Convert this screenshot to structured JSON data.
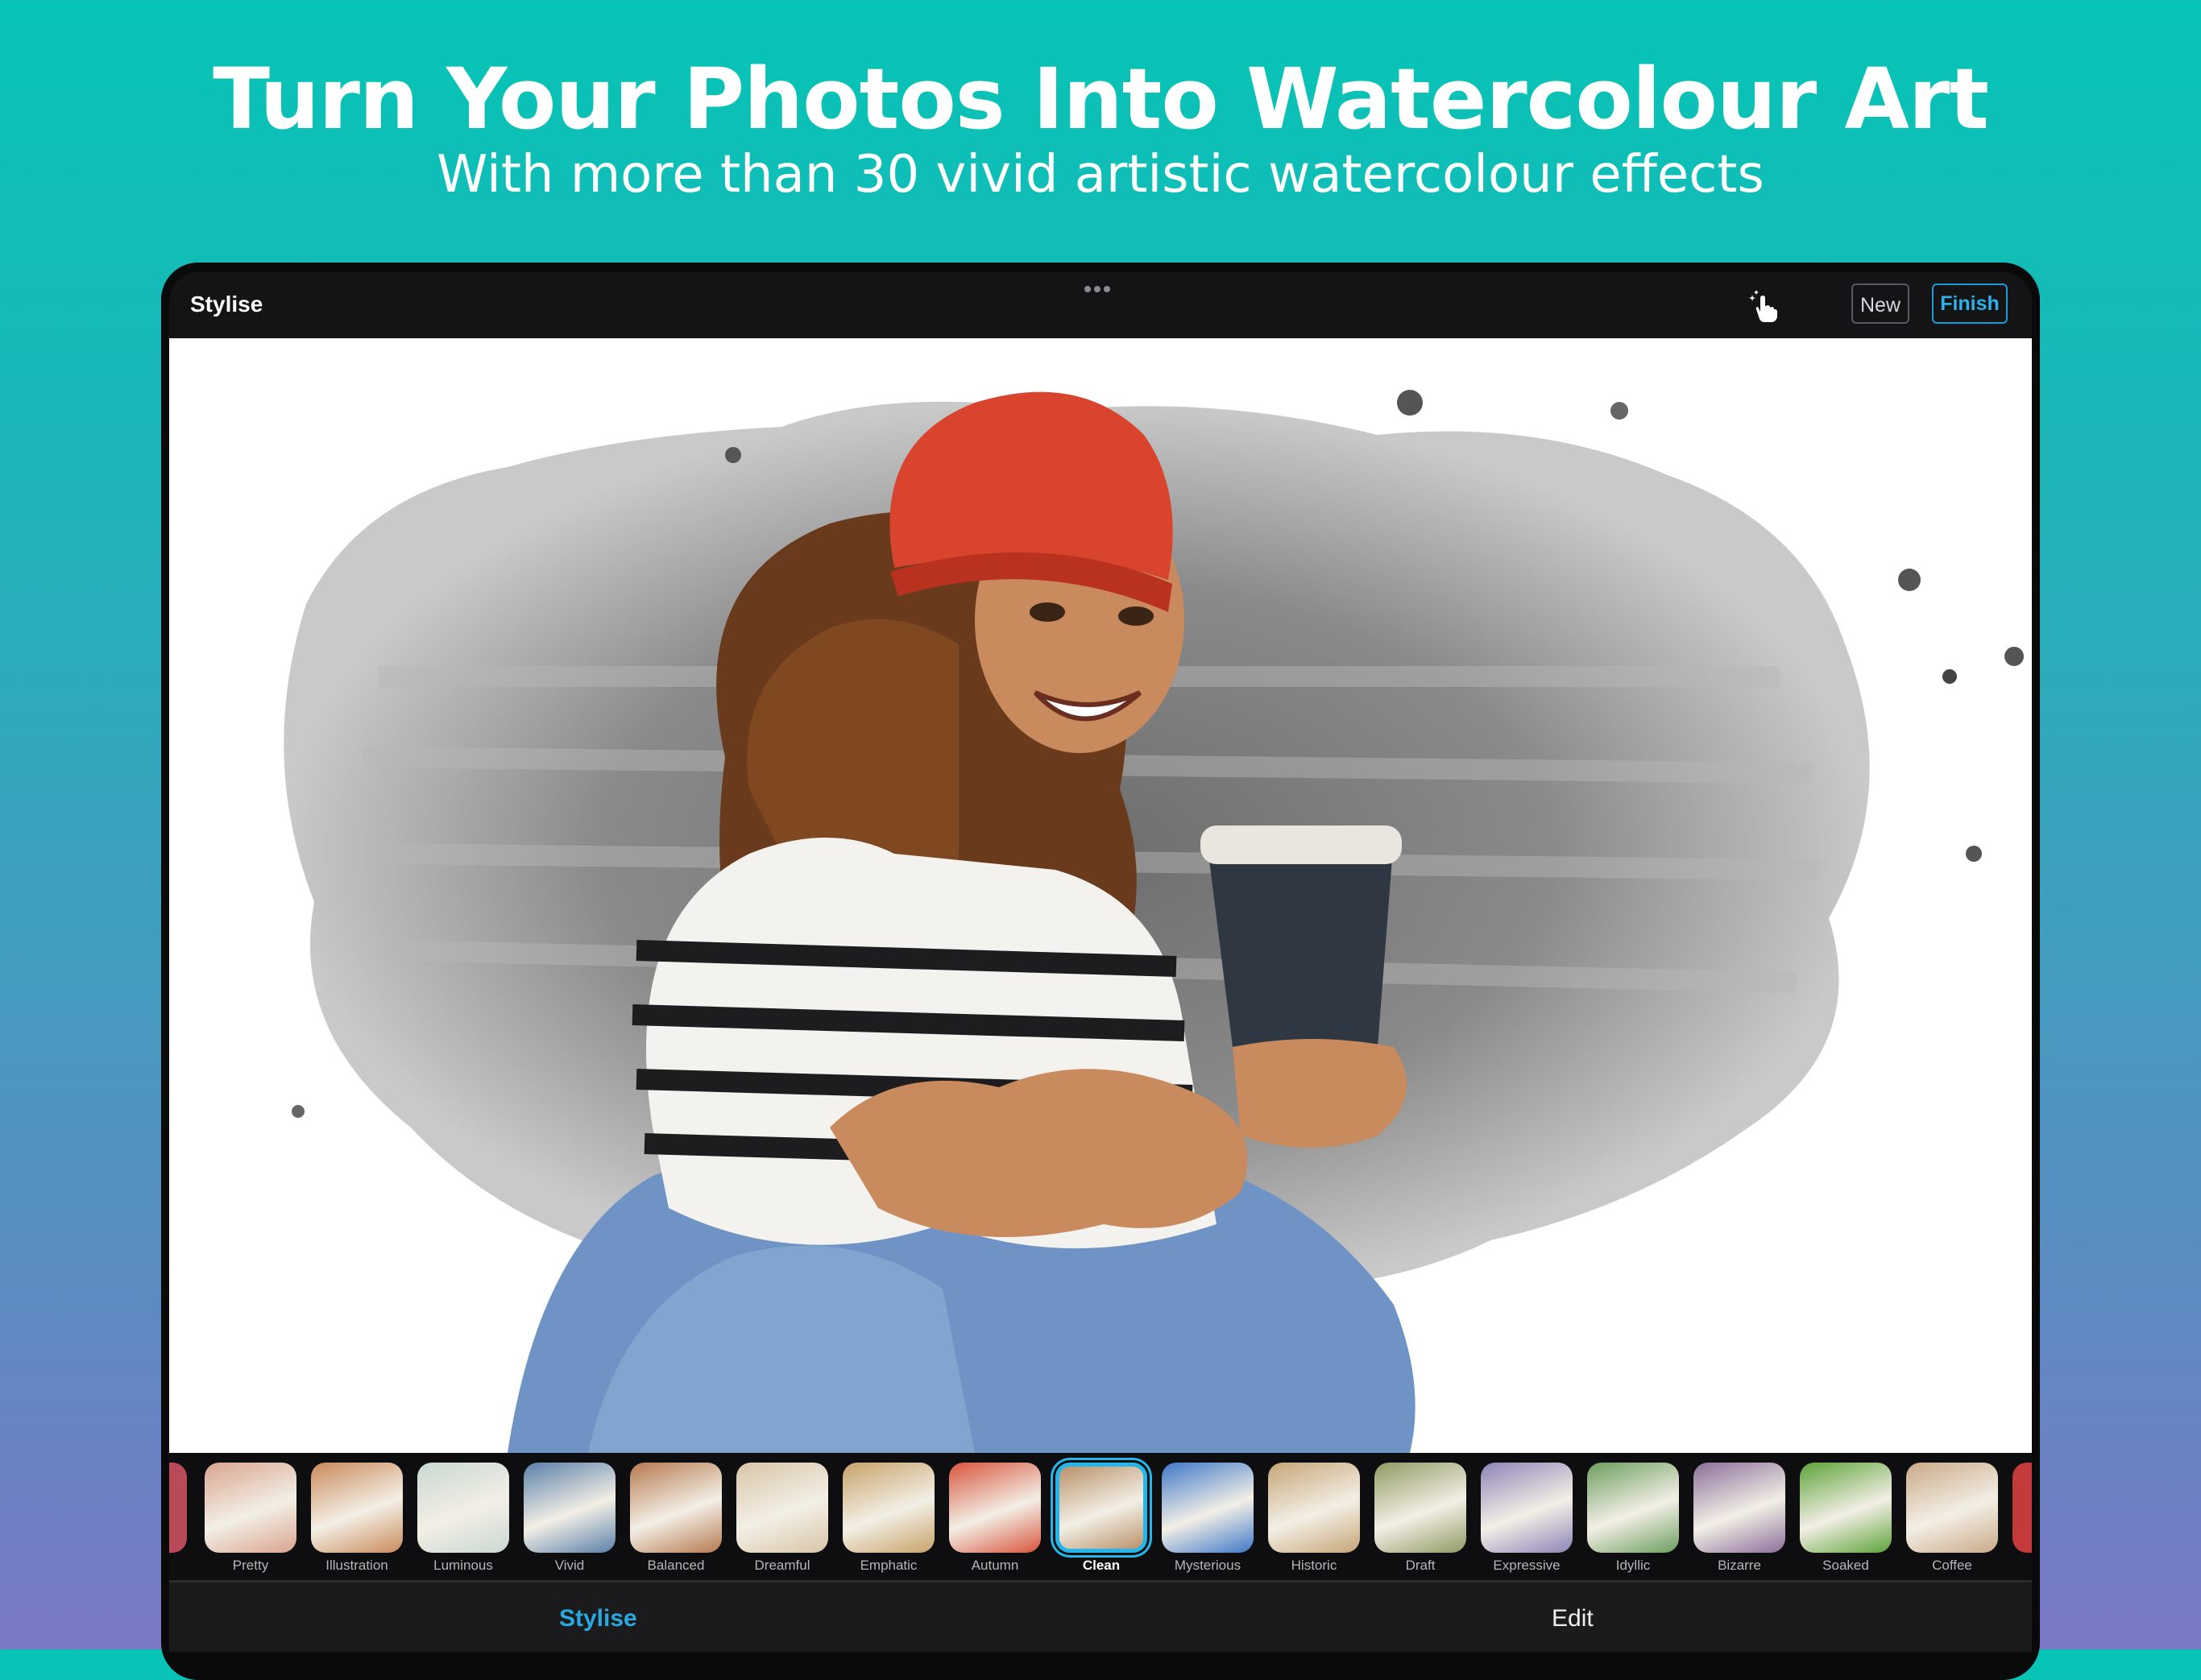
{
  "promo": {
    "headline": "Turn Your Photos Into Watercolour Art",
    "subline": "With more than 30 vivid artistic watercolour effects"
  },
  "app": {
    "title": "Stylise",
    "buttons": {
      "new": "New",
      "finish": "Finish"
    },
    "icons": {
      "more": "more-dots-icon",
      "magic_touch": "magic-touch-icon"
    },
    "accent": "#25b5e8"
  },
  "effects": [
    {
      "label": "Pretty",
      "color": "#d9a48f"
    },
    {
      "label": "Illustration",
      "color": "#c98a5a"
    },
    {
      "label": "Luminous",
      "color": "#c9d8d2"
    },
    {
      "label": "Vivid",
      "color": "#5a7fa8"
    },
    {
      "label": "Balanced",
      "color": "#b6794f"
    },
    {
      "label": "Dreamful",
      "color": "#d8c5a8"
    },
    {
      "label": "Emphatic",
      "color": "#c7a269"
    },
    {
      "label": "Autumn",
      "color": "#d8543c"
    },
    {
      "label": "Clean",
      "color": "#b9926a"
    },
    {
      "label": "Mysterious",
      "color": "#3e78c8"
    },
    {
      "label": "Historic",
      "color": "#c6a577"
    },
    {
      "label": "Draft",
      "color": "#8f9a62"
    },
    {
      "label": "Expressive",
      "color": "#8e84b8"
    },
    {
      "label": "Idyllic",
      "color": "#6c9e5e"
    },
    {
      "label": "Bizarre",
      "color": "#8a6f9a"
    },
    {
      "label": "Soaked",
      "color": "#5da238"
    },
    {
      "label": "Coffee",
      "color": "#c9a987"
    }
  ],
  "selected_effect": "Clean",
  "tabs": {
    "stylise": "Stylise",
    "edit": "Edit"
  }
}
